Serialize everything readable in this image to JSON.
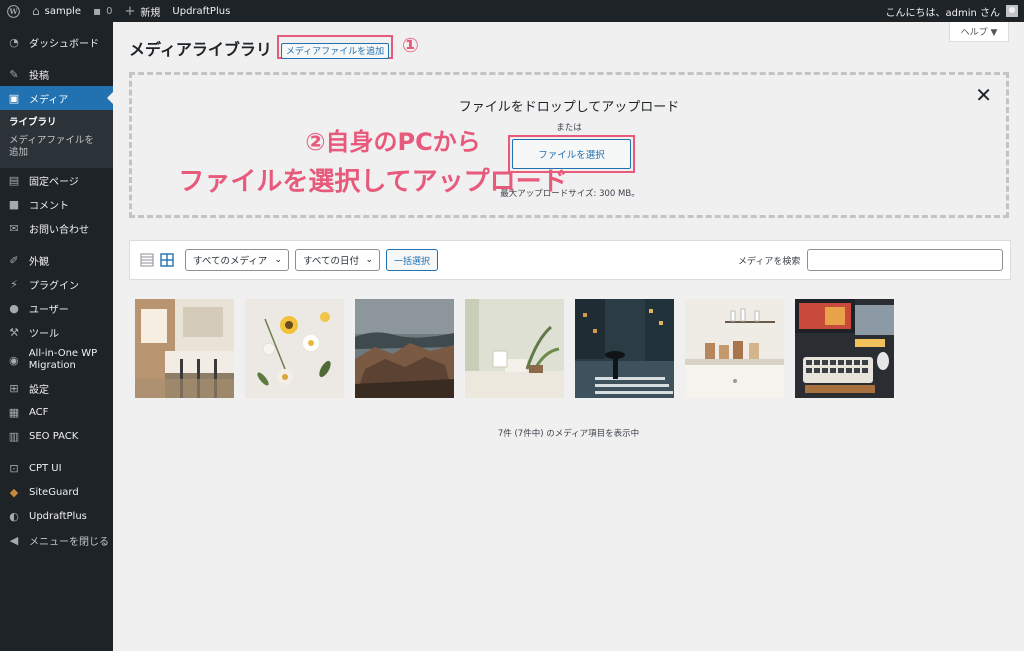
{
  "adminbar": {
    "site_name": "sample",
    "comments_count": "0",
    "new_label": "新規",
    "plugin_label": "UpdraftPlus",
    "greeting": "こんにちは、admin さん"
  },
  "sidebar": {
    "items": [
      {
        "label": "ダッシュボード",
        "icon": "gauge-icon"
      },
      {
        "label": "投稿",
        "icon": "pin-icon"
      },
      {
        "label": "メディア",
        "icon": "media-icon"
      },
      {
        "label": "固定ページ",
        "icon": "page-icon"
      },
      {
        "label": "コメント",
        "icon": "comment-icon"
      },
      {
        "label": "お問い合わせ",
        "icon": "mail-icon"
      },
      {
        "label": "外観",
        "icon": "brush-icon"
      },
      {
        "label": "プラグイン",
        "icon": "plug-icon"
      },
      {
        "label": "ユーザー",
        "icon": "user-icon"
      },
      {
        "label": "ツール",
        "icon": "wrench-icon"
      },
      {
        "label": "All-in-One WP Migration",
        "icon": "migration-icon"
      },
      {
        "label": "設定",
        "icon": "settings-icon"
      },
      {
        "label": "ACF",
        "icon": "acf-icon"
      },
      {
        "label": "SEO PACK",
        "icon": "seo-icon"
      },
      {
        "label": "CPT UI",
        "icon": "cpt-icon"
      },
      {
        "label": "SiteGuard",
        "icon": "shield-icon"
      },
      {
        "label": "UpdraftPlus",
        "icon": "updraft-icon"
      },
      {
        "label": "メニューを閉じる",
        "icon": "collapse-icon"
      }
    ],
    "submenu": [
      "ライブラリ",
      "メディアファイルを追加"
    ]
  },
  "header": {
    "title": "メディアライブラリ",
    "add_new_label": "メディアファイルを追加",
    "annotation_1": "①",
    "help_label": "ヘルプ ▼"
  },
  "uploader": {
    "drop_title": "ファイルをドロップしてアップロード",
    "or_label": "または",
    "select_files_label": "ファイルを選択",
    "max_size": "最大アップロードサイズ: 300 MB。",
    "close_label": "✕",
    "annotation_2_line1": "②自身のPCから",
    "annotation_2_line2": "ファイルを選択してアップロード"
  },
  "toolbar": {
    "media_filter": "すべてのメディア",
    "date_filter": "すべての日付",
    "bulk_select_label": "一括選択",
    "search_label": "メディアを検索",
    "search_value": ""
  },
  "footer": {
    "count_text": "7件 (7件中) のメディア項目を表示中"
  },
  "colors": {
    "admin_dark": "#1d2327",
    "accent_blue": "#2271b1",
    "annotation_pink": "#e75a7c",
    "background": "#f0f0f1"
  }
}
